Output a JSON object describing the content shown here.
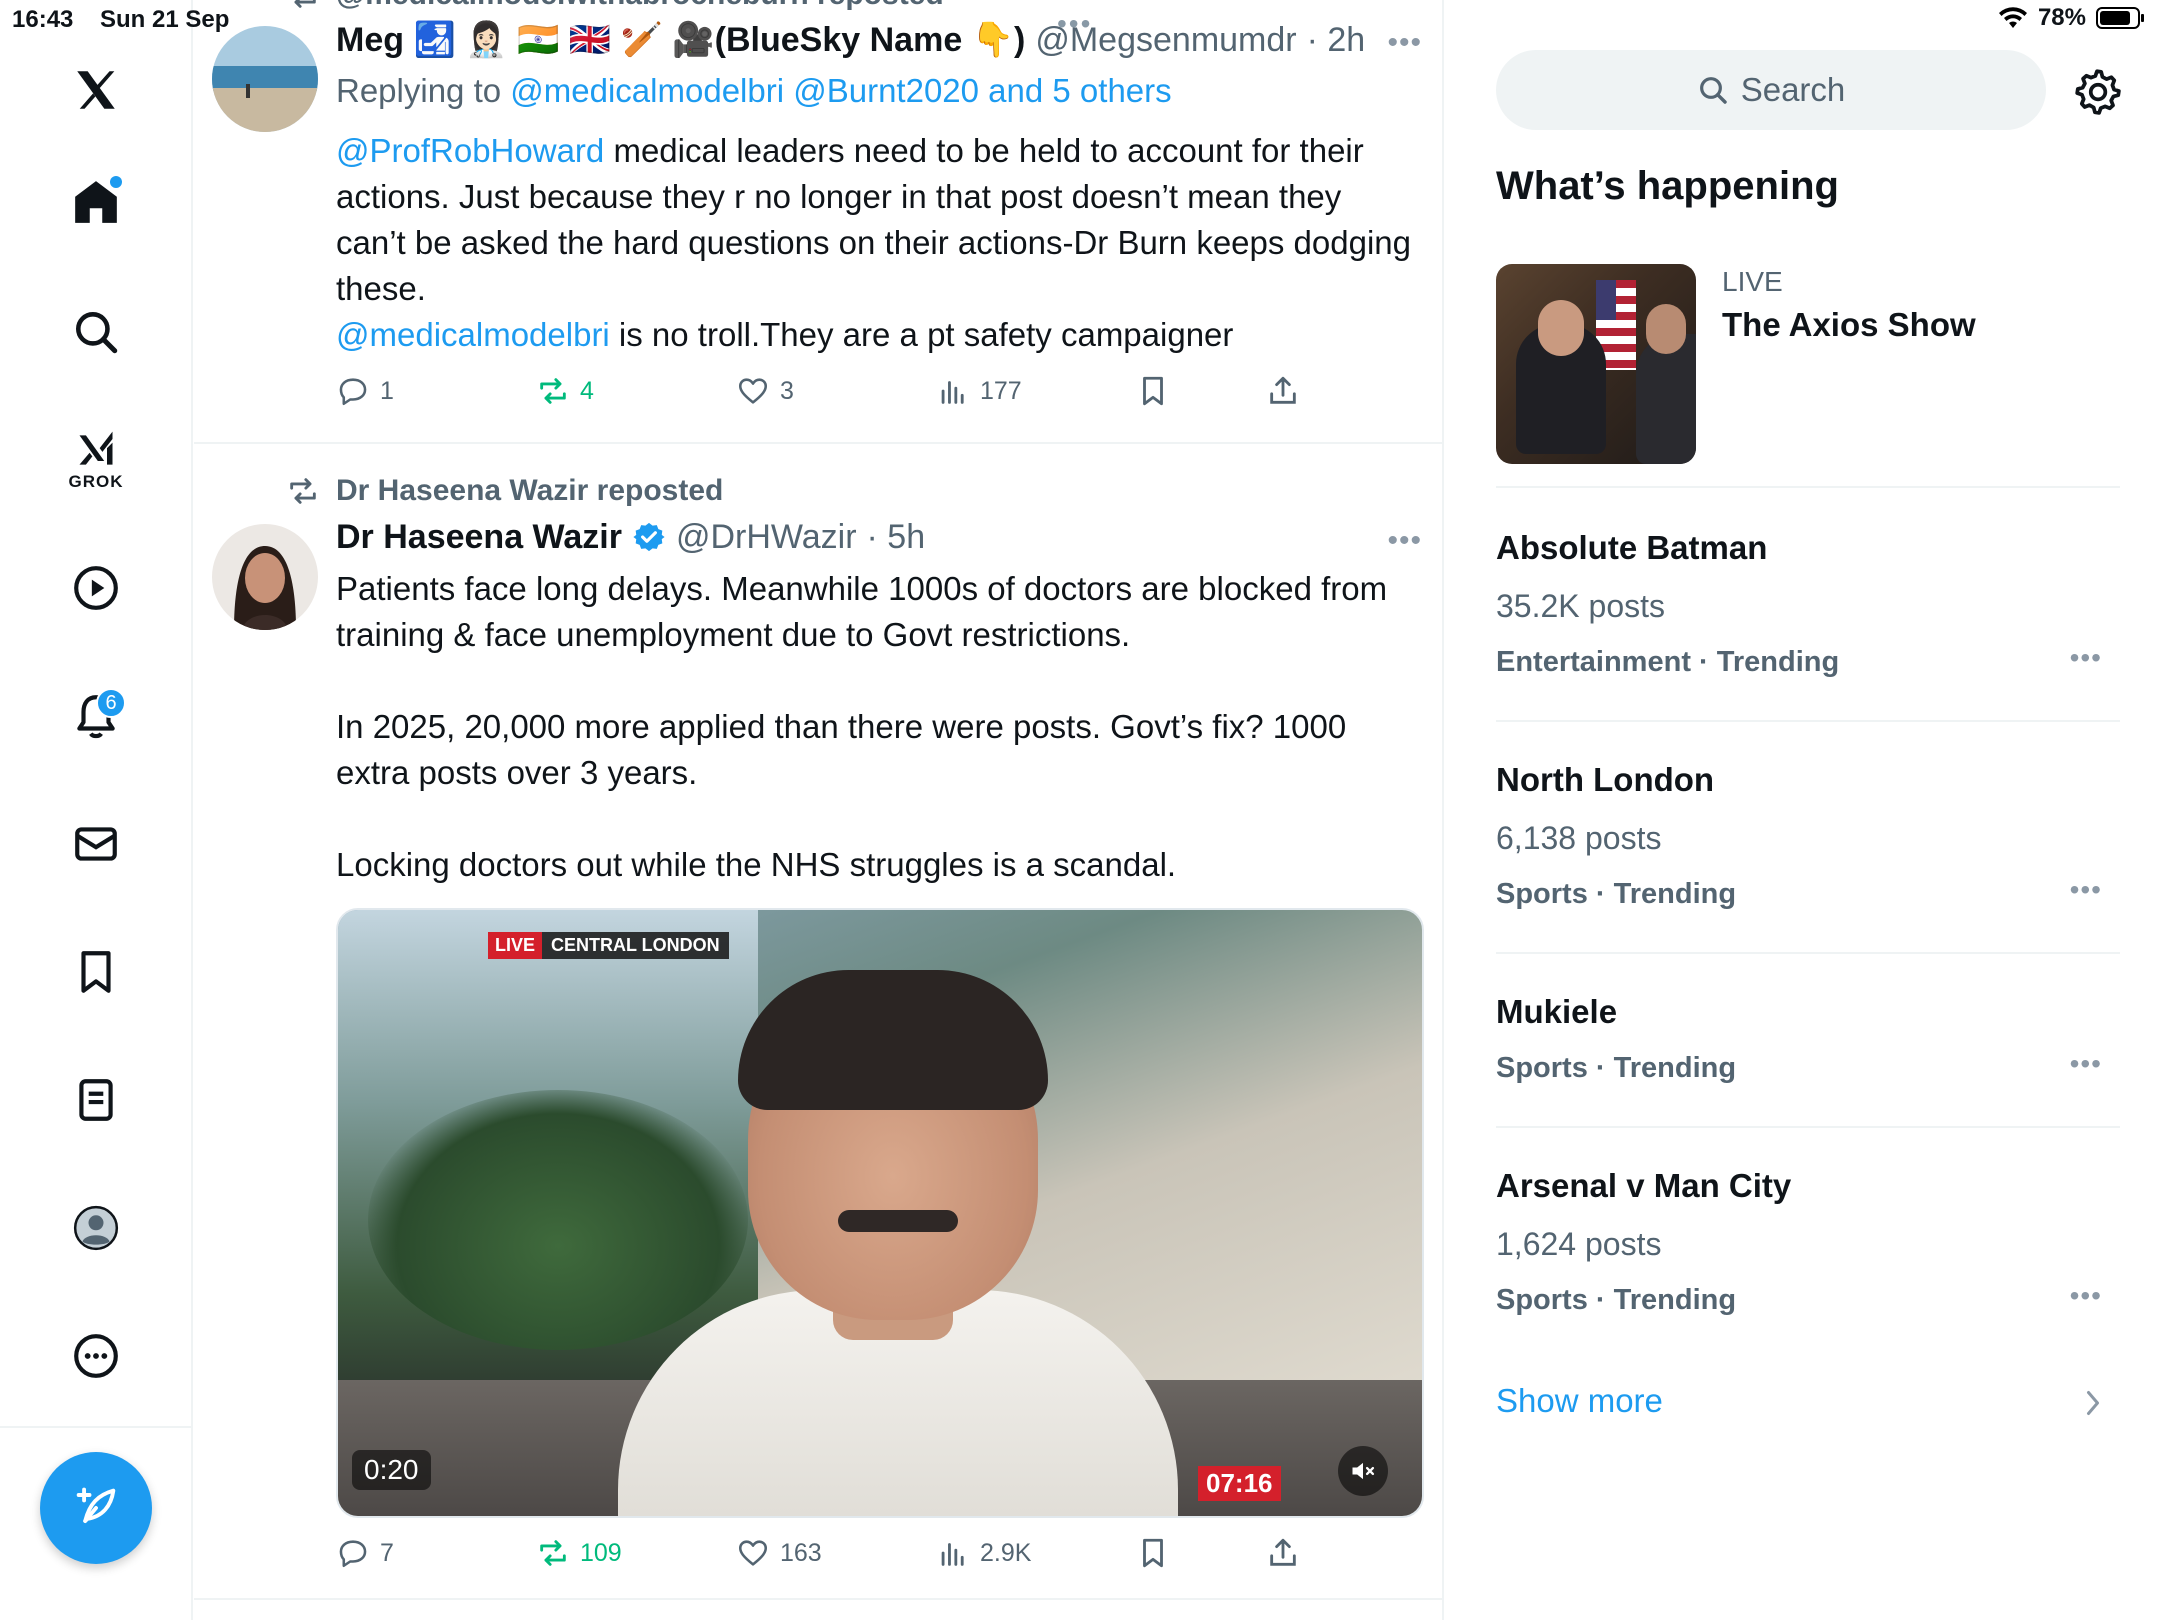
{
  "status": {
    "time": "16:43",
    "date": "Sun 21 Sep",
    "battery": "78%"
  },
  "nav": {
    "grok_label": "GROK",
    "notification_count": "6"
  },
  "tweet1": {
    "repost_header": "@medicalmodelwithabrocheburn reposted",
    "name": "Meg 🛃 👩🏻‍⚕️ 🇮🇳 🇬🇧 🏏 🎥(BlueSky Name 👇)",
    "handle": "@Megsenmumdr",
    "time": "· 2h",
    "reply_prefix": "Replying to",
    "reply_targets": "@medicalmodelbri @Burnt2020 and 5 others",
    "mention1": "@ProfRobHoward",
    "text1": " medical leaders need to be held to account for their actions. Just because they r no longer in that post doesn’t mean they can’t be asked the hard questions on their actions-Dr Burn keeps dodging these.",
    "mention2": "@medicalmodelbri",
    "text2": " is no troll.They are a pt safety campaigner",
    "replies": "1",
    "reposts": "4",
    "likes": "3",
    "views": "177"
  },
  "tweet2": {
    "repost_header": "Dr Haseena Wazir reposted",
    "name": "Dr Haseena Wazir",
    "handle": "@DrHWazir",
    "time": "· 5h",
    "text": "Patients face long delays. Meanwhile 1000s of doctors are blocked from training & face unemployment due to Govt restrictions.\n\nIn 2025, 20,000 more applied than there were posts. Govt’s fix? 1000 extra posts over 3 years.\n\nLocking doctors out while the NHS struggles is a scandal.",
    "video_live": "LIVE",
    "video_location": "CENTRAL LONDON",
    "video_clock": "07:16",
    "video_duration": "0:20",
    "replies": "7",
    "reposts": "109",
    "likes": "163",
    "views": "2.9K"
  },
  "sidebar": {
    "search_placeholder": "Search",
    "section_title": "What’s happening",
    "live": {
      "label": "LIVE",
      "title": "The Axios Show"
    },
    "trends": [
      {
        "name": "Absolute Batman",
        "posts": "35.2K posts",
        "category": "Entertainment · Trending"
      },
      {
        "name": "North London",
        "posts": "6,138 posts",
        "category": "Sports · Trending"
      },
      {
        "name": "Mukiele",
        "posts": "",
        "category": "Sports · Trending"
      },
      {
        "name": "Arsenal v Man City",
        "posts": "1,624 posts",
        "category": "Sports · Trending"
      }
    ],
    "show_more": "Show more"
  },
  "colors": {
    "accent": "#1d9bf0",
    "repost_green": "#00ba7c",
    "secondary_text": "#536471"
  },
  "icons": [
    "x-logo-icon",
    "home-icon",
    "search-icon",
    "grok-icon",
    "video-icon",
    "bell-icon",
    "mail-icon",
    "bookmark-icon",
    "lists-icon",
    "profile-icon",
    "more-icon",
    "compose-icon",
    "gear-icon",
    "verified-icon",
    "reply-icon",
    "repost-icon",
    "like-icon",
    "views-icon",
    "share-icon",
    "mute-icon",
    "chevron-right-icon"
  ]
}
